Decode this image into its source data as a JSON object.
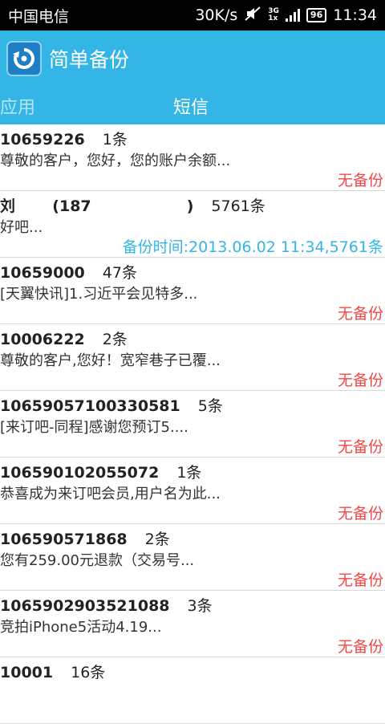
{
  "status_bar": {
    "carrier": "中国电信",
    "speed": "30K/s",
    "network_top": "3G",
    "network_bottom": "1x",
    "battery": "96",
    "time": "11:34"
  },
  "app_bar": {
    "icon": "backup-restore-icon",
    "title": "简单备份"
  },
  "tabs": [
    {
      "label": "应用",
      "active": false
    },
    {
      "label": "短信",
      "active": true
    }
  ],
  "colors": {
    "accent": "#33b5e5",
    "no_backup": "#f04848"
  },
  "sms_list": [
    {
      "number": "10659226",
      "count": "1条",
      "snippet": "尊敬的客户，您好，您的账户余额...",
      "status": "无备份",
      "backed_up": false
    },
    {
      "number": "刘       (187                  )",
      "count": "5761条",
      "snippet": "好吧...",
      "status": "备份时间:2013.06.02 11:34,5761条",
      "backed_up": true
    },
    {
      "number": "10659000",
      "count": "47条",
      "snippet": "[天翼快讯]1.习近平会见特多...",
      "status": "无备份",
      "backed_up": false
    },
    {
      "number": "10006222",
      "count": "2条",
      "snippet": "尊敬的客户,您好！宽窄巷子已覆...",
      "status": "无备份",
      "backed_up": false
    },
    {
      "number": "1065905710033058​1",
      "count": "5条",
      "snippet": "[来订吧-同程]感谢您预订5....",
      "status": "无备份",
      "backed_up": false
    },
    {
      "number": "106590102055072",
      "count": "1条",
      "snippet": "恭喜成为来订吧会员,用户名为此...",
      "status": "无备份",
      "backed_up": false
    },
    {
      "number": "106590571868",
      "count": "2条",
      "snippet": "您有259.00元退款（交易号...",
      "status": "无备份",
      "backed_up": false
    },
    {
      "number": "1065902903521088",
      "count": "3条",
      "snippet": "竞拍iPhone5活动4.19...",
      "status": "无备份",
      "backed_up": false
    },
    {
      "number": "10001",
      "count": "16条",
      "snippet": "",
      "status": "",
      "backed_up": false
    }
  ]
}
